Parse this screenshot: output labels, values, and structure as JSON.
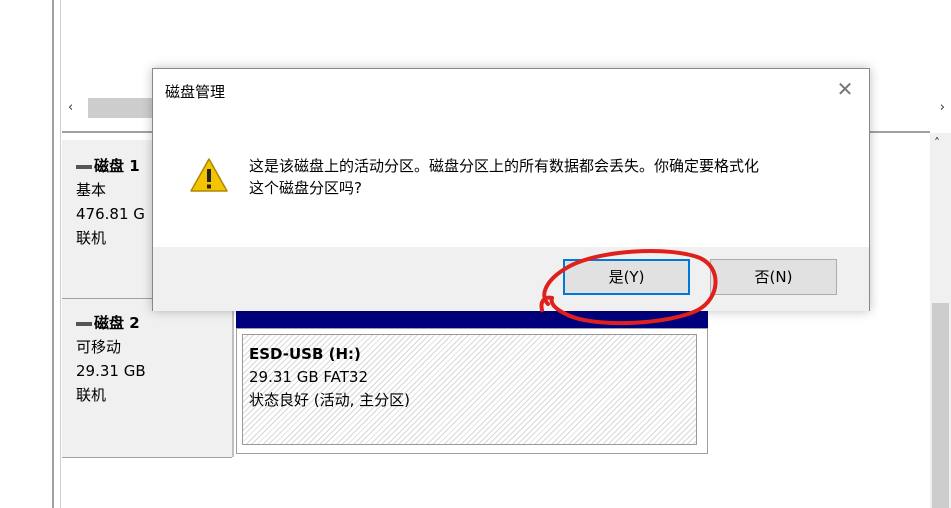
{
  "scrollbar": {
    "left_arrow": "‹",
    "right_arrow": "›",
    "up_arrow": "˄"
  },
  "disks": [
    {
      "name": "磁盘 1",
      "type": "基本",
      "size": "476.81 G",
      "status": "联机"
    },
    {
      "name": "磁盘 2",
      "type": "可移动",
      "size": "29.31 GB",
      "status": "联机"
    }
  ],
  "partition": {
    "name": "ESD-USB  (H:)",
    "size_fs": "29.31 GB FAT32",
    "status": "状态良好 (活动, 主分区)"
  },
  "dialog": {
    "title": "磁盘管理",
    "close_glyph": "✕",
    "icon": "warning-icon",
    "message_line1": "这是该磁盘上的活动分区。磁盘分区上的所有数据都会丢失。你确定要格式化",
    "message_line2": "这个磁盘分区吗?",
    "yes_label": "是(Y)",
    "no_label": "否(N)"
  },
  "colors": {
    "partition_header": "#00007f",
    "annotation": "#e0201c",
    "focus": "#0078d7"
  }
}
